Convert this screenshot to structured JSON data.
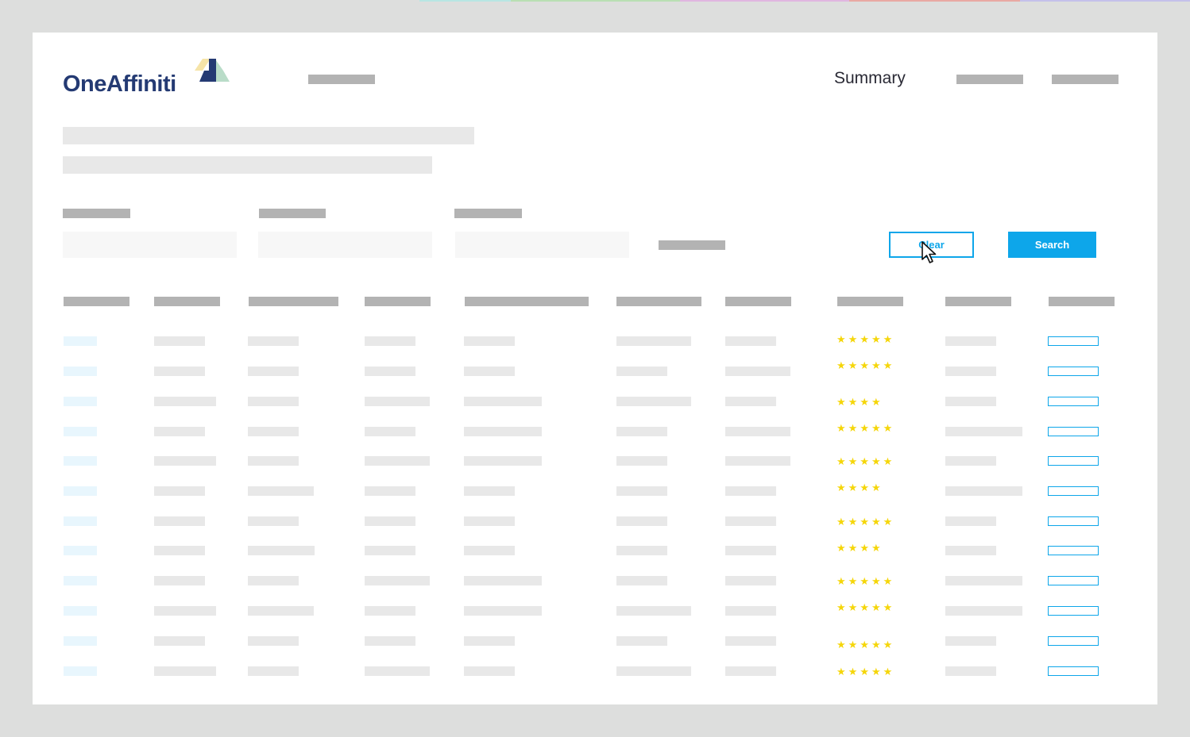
{
  "logo": {
    "text": "OneAffiniti"
  },
  "nav": {
    "summary_label": "Summary"
  },
  "filters": {
    "clear_label": "Clear",
    "search_label": "Search"
  },
  "colors": {
    "brand_navy": "#243a73",
    "accent_blue": "#0da6ea",
    "star_yellow": "#f5d60a",
    "placeholder_dark": "#b3b3b3",
    "placeholder_light": "#e8e8e8",
    "background": "#dddedd"
  },
  "table": {
    "column_count": 10,
    "rows": [
      {
        "rating": 5
      },
      {
        "rating": 5
      },
      {
        "rating": 4
      },
      {
        "rating": 5
      },
      {
        "rating": 5
      },
      {
        "rating": 4
      },
      {
        "rating": 5
      },
      {
        "rating": 4
      },
      {
        "rating": 5
      },
      {
        "rating": 5
      },
      {
        "rating": 5
      },
      {
        "rating": 5
      }
    ]
  },
  "icons": {
    "cursor": "mouse-pointer-icon",
    "star": "star-icon",
    "logo_mark": "logo-mark-icon"
  }
}
